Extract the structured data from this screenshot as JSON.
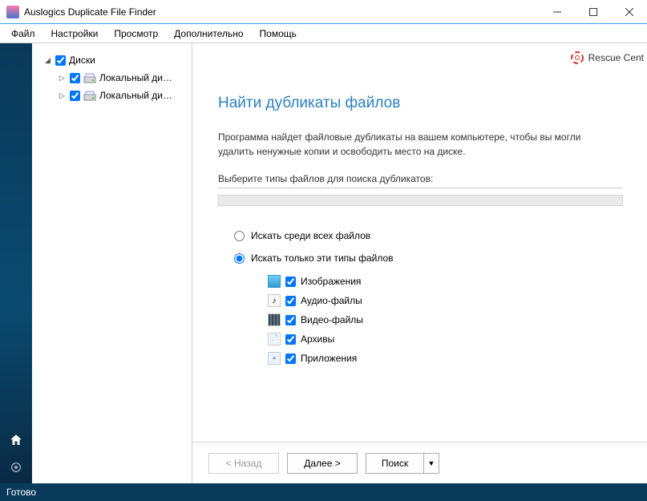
{
  "window": {
    "title": "Auslogics Duplicate File Finder"
  },
  "menu": {
    "file": "Файл",
    "settings": "Настройки",
    "view": "Просмотр",
    "extra": "Дополнительно",
    "help": "Помощь"
  },
  "rescue": {
    "label": "Rescue Cent"
  },
  "tree": {
    "root": "Диски",
    "items": [
      "Локальный ди…",
      "Локальный ди…"
    ]
  },
  "page": {
    "heading": "Найти дубликаты файлов",
    "description": "Программа найдет файловые дубликаты на вашем компьютере, чтобы вы могли удалить ненужные копии и освободить место на диске.",
    "section_label": "Выберите типы файлов для поиска дубликатов:",
    "radio_all": "Искать среди всех файлов",
    "radio_types": "Искать только эти типы файлов",
    "types": {
      "images": "Изображения",
      "audio": "Аудио-файлы",
      "video": "Видео-файлы",
      "archives": "Архивы",
      "apps": "Приложения"
    }
  },
  "buttons": {
    "back": "< Назад",
    "next": "Далее >",
    "search": "Поиск"
  },
  "status": "Готово"
}
